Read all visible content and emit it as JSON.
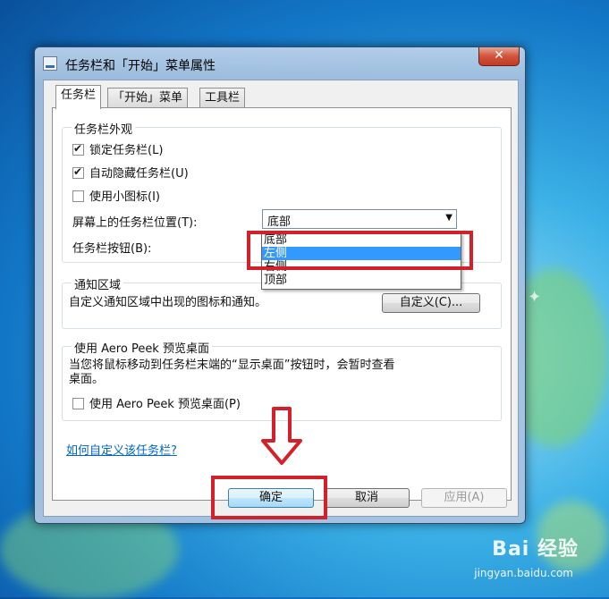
{
  "window": {
    "title": "任务栏和「开始」菜单属性",
    "close_label": "✕"
  },
  "tabs": [
    {
      "label": "任务栏"
    },
    {
      "label": "「开始」菜单"
    },
    {
      "label": "工具栏"
    }
  ],
  "appearance": {
    "group_title": "任务栏外观",
    "lock_label": "锁定任务栏(L)",
    "lock_checked": true,
    "autohide_label": "自动隐藏任务栏(U)",
    "autohide_checked": true,
    "small_icons_label": "使用小图标(I)",
    "small_icons_checked": false,
    "position_label": "屏幕上的任务栏位置(T):",
    "position_value": "底部",
    "buttons_label": "任务栏按钮(B):",
    "position_options": [
      "底部",
      "左侧",
      "右侧",
      "顶部"
    ],
    "highlighted_option": "左侧"
  },
  "notification": {
    "group_title": "通知区域",
    "description": "自定义通知区域中出现的图标和通知。",
    "customize_button": "自定义(C)..."
  },
  "aero": {
    "group_title": "使用 Aero Peek 预览桌面",
    "description_line1": "当您将鼠标移动到任务栏末端的“显示桌面”按钮时，会暂时查看",
    "description_line2": "桌面。",
    "checkbox_label": "使用 Aero Peek 预览桌面(P)",
    "checked": false
  },
  "help_link": "如何自定义该任务栏?",
  "footer": {
    "ok": "确定",
    "cancel": "取消",
    "apply": "应用(A)"
  },
  "watermark": {
    "brand": "Bai  经验",
    "url": "jingyan.baidu.com"
  },
  "colors": {
    "highlight": "#3399ff",
    "annotation_red": "#d4202a"
  }
}
